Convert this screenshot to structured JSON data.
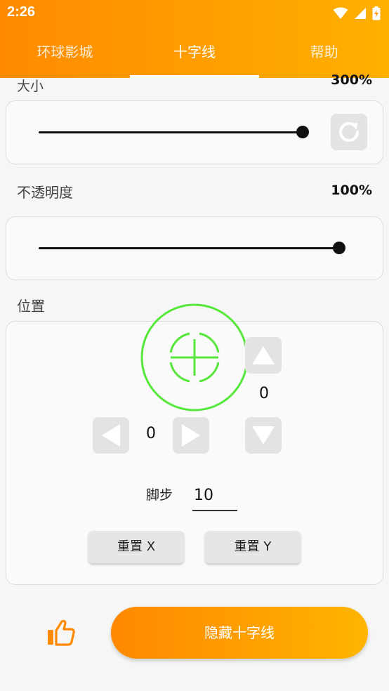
{
  "status_bar": {
    "time": "2:26"
  },
  "tabs": [
    {
      "label": "环球影城",
      "active": false
    },
    {
      "label": "十字线",
      "active": true
    },
    {
      "label": "帮助",
      "active": false
    }
  ],
  "size": {
    "label": "大小",
    "value": "300%"
  },
  "opacity": {
    "label": "不透明度",
    "value": "100%"
  },
  "position": {
    "label": "位置",
    "x": "0",
    "y": "0",
    "step_label": "脚步",
    "step_value": "10",
    "reset_x_label": "重置 X",
    "reset_y_label": "重置 Y"
  },
  "hide_button": {
    "label": "隐藏十字线"
  },
  "colors": {
    "accent_start": "#ff8a00",
    "accent_end": "#ffb000",
    "crosshair": "#55e83a"
  },
  "sliders": {
    "size_level": 1.0,
    "opacity_level": 1.0
  }
}
